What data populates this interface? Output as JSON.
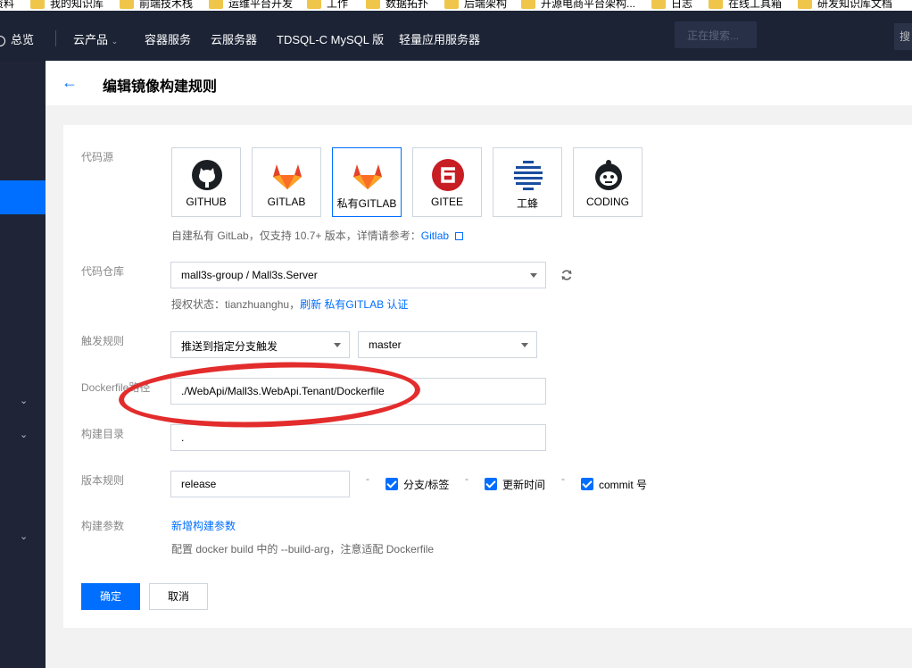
{
  "bookmarks": [
    "资料",
    "我的知识库",
    "前端技术栈",
    "运维平台开发",
    "工作",
    "数据拓扑",
    "后端架构",
    "开源电商平台架构...",
    "日志",
    "在线工具箱",
    "研发知识库文档"
  ],
  "topnav": {
    "overview": "总览",
    "cloud_products": "云产品",
    "items": [
      "容器服务",
      "云服务器",
      "TDSQL-C MySQL 版",
      "轻量应用服务器"
    ],
    "search_placeholder": "正在搜索...",
    "right_button": "搜"
  },
  "page": {
    "back_icon": "arrow-left-icon",
    "title": "编辑镜像构建规则"
  },
  "form": {
    "code_source": {
      "label": "代码源",
      "options": [
        {
          "name": "GITHUB",
          "icon": "github-icon"
        },
        {
          "name": "GITLAB",
          "icon": "gitlab-icon"
        },
        {
          "name": "私有GITLAB",
          "icon": "gitlab-icon"
        },
        {
          "name": "GITEE",
          "icon": "gitee-icon"
        },
        {
          "name": "工蜂",
          "icon": "gongfeng-icon"
        },
        {
          "name": "CODING",
          "icon": "coding-icon"
        }
      ],
      "selected": "私有GITLAB",
      "hint": "自建私有 GitLab，仅支持 10.7+ 版本，详情请参考：",
      "hint_link": "Gitlab"
    },
    "repo": {
      "label": "代码仓库",
      "value": "mall3s-group / Mall3s.Server",
      "auth_prefix": "授权状态：tianzhuanghu，",
      "auth_link": "刷新 私有GITLAB 认证"
    },
    "trigger": {
      "label": "触发规则",
      "rule": "推送到指定分支触发",
      "branch": "master"
    },
    "dockerfile": {
      "label": "Dockerfile路径",
      "value": "./WebApi/Mall3s.WebApi.Tenant/Dockerfile"
    },
    "build_dir": {
      "label": "构建目录",
      "value": "."
    },
    "version": {
      "label": "版本规则",
      "value": "release",
      "separator": "-",
      "checkboxes": [
        "分支/标签",
        "更新时间",
        "commit 号"
      ]
    },
    "build_args": {
      "label": "构建参数",
      "add_link": "新增构建参数",
      "hint": "配置 docker build 中的 --build-arg，注意适配 Dockerfile"
    },
    "buttons": {
      "confirm": "确定",
      "cancel": "取消"
    }
  },
  "colors": {
    "accent": "#006eff",
    "nav_bg": "#1c2335",
    "annotation": "#e32c2c"
  }
}
